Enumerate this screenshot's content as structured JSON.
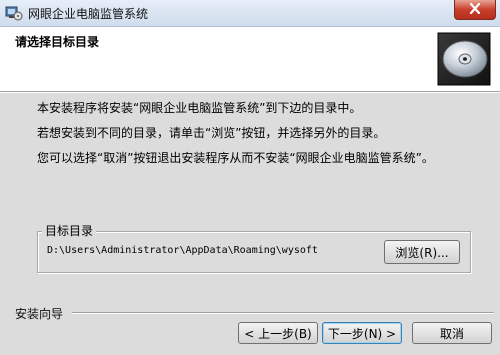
{
  "window": {
    "title": "网眼企业电脑监管系统",
    "close_label": "✕"
  },
  "header": {
    "title": "请选择目标目录"
  },
  "body": {
    "line1": "本安装程序将安装“网眼企业电脑监管系统”到下边的目录中。",
    "line2": "若想安装到不同的目录，请单击“浏览”按钮，并选择另外的目录。",
    "line3": "您可以选择“取消”按钮退出安装程序从而不安装“网眼企业电脑监管系统”。"
  },
  "target": {
    "group_label": "目标目录",
    "path": "D:\\Users\\Administrator\\AppData\\Roaming\\wysoft",
    "browse_label": "浏览(R)..."
  },
  "footer": {
    "wizard_label": "安装向导",
    "back_label": "< 上一步(B)",
    "next_label": "下一步(N) >",
    "cancel_label": "取消"
  },
  "colors": {
    "titlebar": "#cfdcec",
    "close_button": "#c8402c",
    "dialog_bg": "#dcdcdc",
    "header_bg": "#ffffff"
  },
  "icons": [
    "setup-app-icon",
    "close-icon",
    "cd-disc-icon"
  ]
}
